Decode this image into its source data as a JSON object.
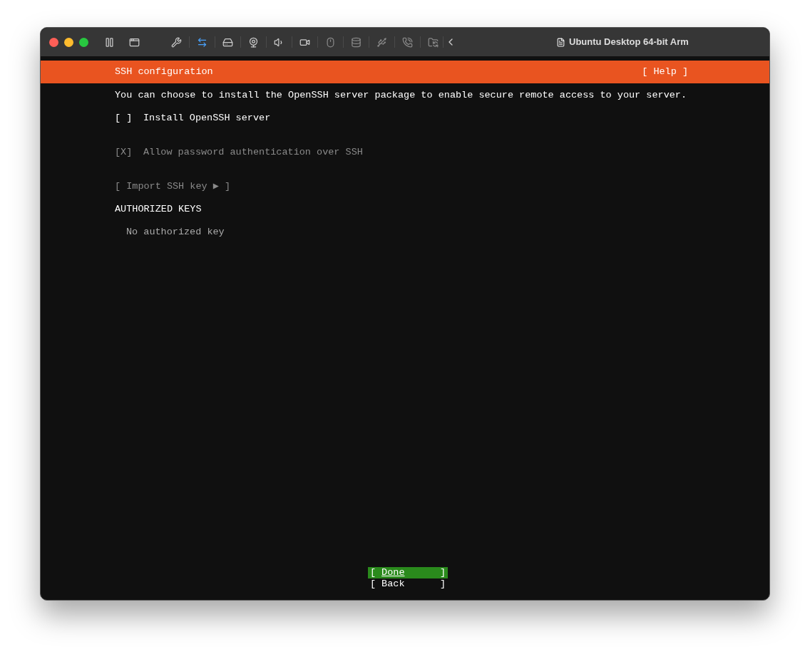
{
  "window": {
    "title": "Ubuntu Desktop 64-bit Arm"
  },
  "toolbar": {
    "network_active": true
  },
  "header": {
    "title": "SSH configuration",
    "help": "[ Help ]"
  },
  "description": "You can choose to install the OpenSSH server package to enable secure remote access to your server.",
  "options": [
    {
      "box": "[ ]",
      "label": "Install OpenSSH server",
      "disabled": false
    },
    {
      "box": "[X]",
      "label": "Allow password authentication over SSH",
      "disabled": true
    }
  ],
  "import_button": {
    "label": "[ Import SSH key ▶ ]",
    "disabled": true
  },
  "authorized_keys": {
    "heading": "AUTHORIZED KEYS",
    "empty": "No authorized key"
  },
  "buttons": [
    {
      "open": "[",
      "label": "Done",
      "close": "]",
      "selected": true
    },
    {
      "open": "[",
      "label": "Back",
      "close": "]",
      "selected": false
    }
  ]
}
